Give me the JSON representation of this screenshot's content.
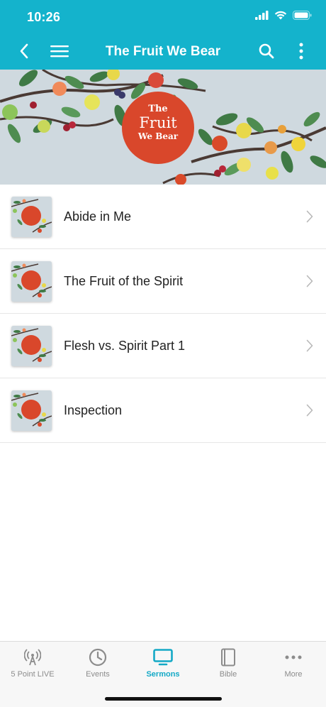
{
  "status": {
    "time": "10:26",
    "icons": [
      "signal-bars-icon",
      "wifi-icon",
      "battery-icon"
    ]
  },
  "header": {
    "title": "The Fruit We Bear",
    "left_icons": [
      "back-arrow-icon",
      "hamburger-menu-icon"
    ],
    "right_icons": [
      "search-icon",
      "more-vertical-icon"
    ],
    "background": "#14b3cc"
  },
  "hero": {
    "line1": "The",
    "line2": "Fruit",
    "line3": "We Bear",
    "circle_color": "#d9472b",
    "background": "#cfd9df"
  },
  "sermons": [
    {
      "title": "Abide in Me"
    },
    {
      "title": "The Fruit of the Spirit"
    },
    {
      "title": "Flesh vs. Spirit Part 1"
    },
    {
      "title": "Inspection"
    }
  ],
  "tabs": [
    {
      "label": "5 Point LIVE",
      "icon": "broadcast-antenna-icon",
      "active": false
    },
    {
      "label": "Events",
      "icon": "clock-icon",
      "active": false
    },
    {
      "label": "Sermons",
      "icon": "monitor-icon",
      "active": true
    },
    {
      "label": "Bible",
      "icon": "book-icon",
      "active": false
    },
    {
      "label": "More",
      "icon": "more-horizontal-icon",
      "active": false
    }
  ],
  "colors": {
    "accent": "#14b3cc",
    "active_tab": "#14a9c6",
    "inactive_tab": "#8c8c8c"
  }
}
